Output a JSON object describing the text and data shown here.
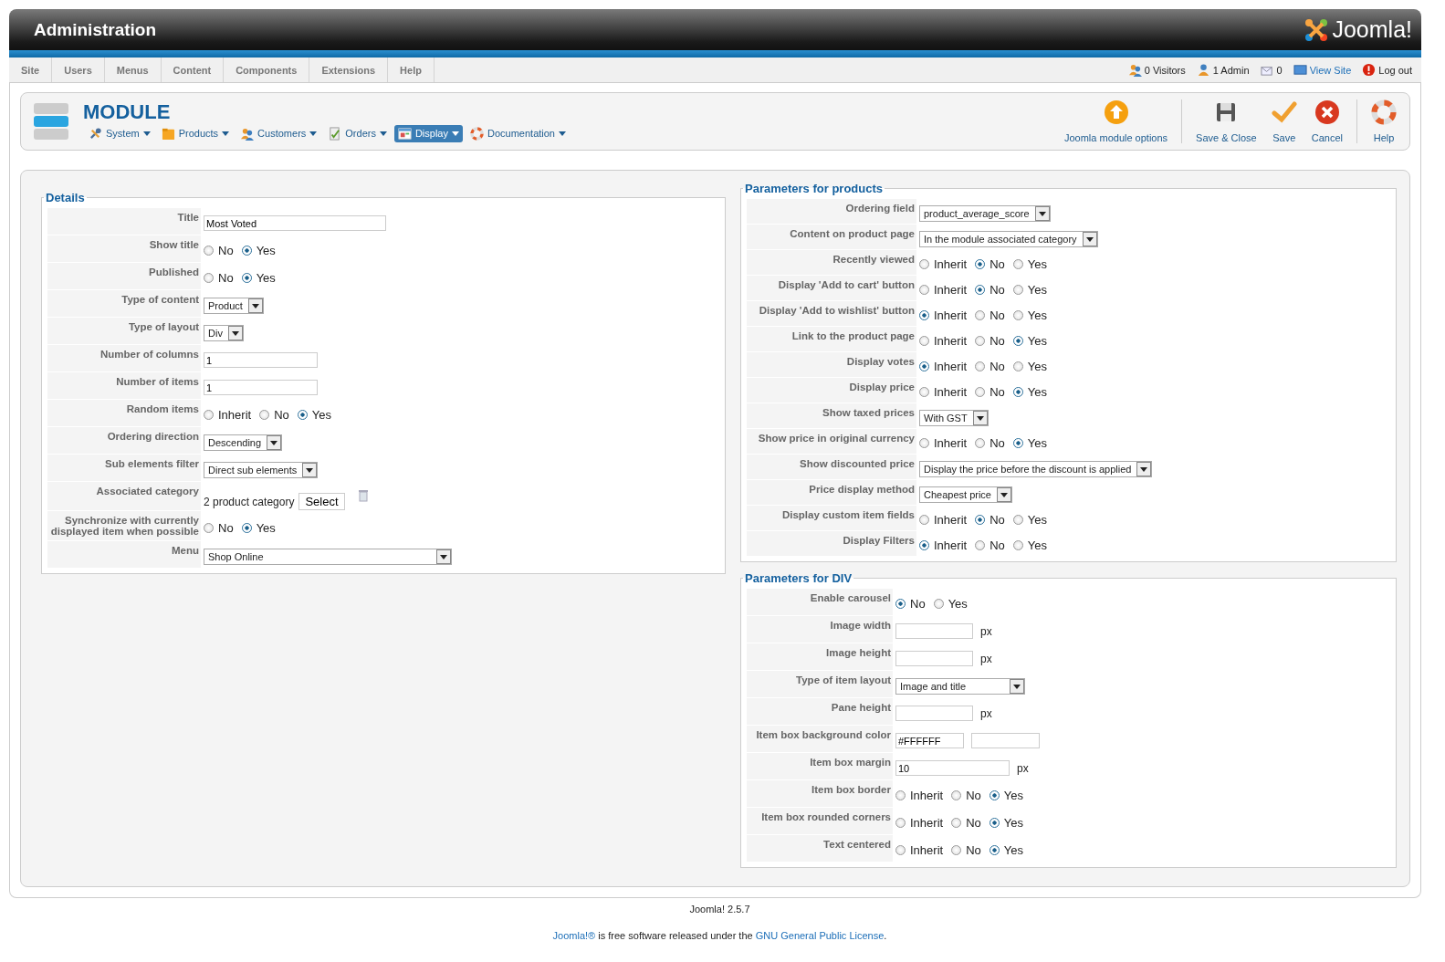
{
  "header": {
    "title": "Administration",
    "logo": "Joomla!"
  },
  "menu": [
    "Site",
    "Users",
    "Menus",
    "Content",
    "Components",
    "Extensions",
    "Help"
  ],
  "status": [
    {
      "label": "0 Visitors",
      "link": false
    },
    {
      "label": "1 Admin",
      "link": false
    },
    {
      "label": "0",
      "link": false
    },
    {
      "label": "View Site",
      "link": true
    },
    {
      "label": "Log out",
      "link": false
    }
  ],
  "toolbar": {
    "title": "MODULE",
    "submenu": [
      {
        "label": "System",
        "selected": false
      },
      {
        "label": "Products",
        "selected": false
      },
      {
        "label": "Customers",
        "selected": false
      },
      {
        "label": "Orders",
        "selected": false
      },
      {
        "label": "Display",
        "selected": true
      },
      {
        "label": "Documentation",
        "selected": false
      }
    ],
    "buttons": [
      "Joomla module options",
      "Save & Close",
      "Save",
      "Cancel",
      "Help"
    ]
  },
  "columns": [
    {
      "sections": [
        {
          "legend": "Details",
          "rows": [
            {
              "label": "Title",
              "kind": "text",
              "value": "Most Voted"
            },
            {
              "label": "Show title",
              "kind": "radio",
              "options": [
                {
                  "label": "No",
                  "selected": false
                },
                {
                  "label": "Yes",
                  "selected": true
                }
              ]
            },
            {
              "label": "Published",
              "kind": "radio",
              "options": [
                {
                  "label": "No",
                  "selected": false
                },
                {
                  "label": "Yes",
                  "selected": true
                }
              ]
            },
            {
              "label": "Type of content",
              "kind": "select",
              "value": "Product"
            },
            {
              "label": "Type of layout",
              "kind": "select",
              "value": "Div"
            },
            {
              "label": "Number of columns",
              "kind": "text",
              "value": "1"
            },
            {
              "label": "Number of items",
              "kind": "text",
              "value": "1"
            },
            {
              "label": "Random items",
              "kind": "radio",
              "options": [
                {
                  "label": "Inherit",
                  "selected": false
                },
                {
                  "label": "No",
                  "selected": false
                },
                {
                  "label": "Yes",
                  "selected": true
                }
              ]
            },
            {
              "label": "Ordering direction",
              "kind": "select",
              "value": "Descending"
            },
            {
              "label": "Sub elements filter",
              "kind": "select",
              "value": "Direct sub elements"
            },
            {
              "label": "Associated category",
              "kind": "category",
              "value": "2 product category",
              "button": "Select"
            },
            {
              "label": "Synchronize with currently displayed item when possible",
              "kind": "radio",
              "options": [
                {
                  "label": "No",
                  "selected": false
                },
                {
                  "label": "Yes",
                  "selected": true
                }
              ]
            },
            {
              "label": "Menu",
              "kind": "select",
              "value": "Shop Online"
            }
          ]
        }
      ]
    },
    {
      "sections": [
        {
          "legend": "Parameters for products",
          "rows": [
            {
              "label": "Ordering field",
              "kind": "select",
              "value": "product_average_score"
            },
            {
              "label": "Content on product page",
              "kind": "select",
              "value": "In the module associated category"
            },
            {
              "label": "Recently viewed",
              "kind": "radio",
              "options": [
                {
                  "label": "Inherit",
                  "selected": false
                },
                {
                  "label": "No",
                  "selected": true
                },
                {
                  "label": "Yes",
                  "selected": false
                }
              ]
            },
            {
              "label": "Display 'Add to cart' button",
              "kind": "radio",
              "options": [
                {
                  "label": "Inherit",
                  "selected": false
                },
                {
                  "label": "No",
                  "selected": true
                },
                {
                  "label": "Yes",
                  "selected": false
                }
              ]
            },
            {
              "label": "Display 'Add to wishlist' button",
              "kind": "radio",
              "options": [
                {
                  "label": "Inherit",
                  "selected": true
                },
                {
                  "label": "No",
                  "selected": false
                },
                {
                  "label": "Yes",
                  "selected": false
                }
              ]
            },
            {
              "label": "Link to the product page",
              "kind": "radio",
              "options": [
                {
                  "label": "Inherit",
                  "selected": false
                },
                {
                  "label": "No",
                  "selected": false
                },
                {
                  "label": "Yes",
                  "selected": true
                }
              ]
            },
            {
              "label": "Display votes",
              "kind": "radio",
              "options": [
                {
                  "label": "Inherit",
                  "selected": true
                },
                {
                  "label": "No",
                  "selected": false
                },
                {
                  "label": "Yes",
                  "selected": false
                }
              ]
            },
            {
              "label": "Display price",
              "kind": "radio",
              "options": [
                {
                  "label": "Inherit",
                  "selected": false
                },
                {
                  "label": "No",
                  "selected": false
                },
                {
                  "label": "Yes",
                  "selected": true
                }
              ]
            },
            {
              "label": "Show taxed prices",
              "kind": "select",
              "value": "With GST"
            },
            {
              "label": "Show price in original currency",
              "kind": "radio",
              "options": [
                {
                  "label": "Inherit",
                  "selected": false
                },
                {
                  "label": "No",
                  "selected": false
                },
                {
                  "label": "Yes",
                  "selected": true
                }
              ]
            },
            {
              "label": "Show discounted price",
              "kind": "select",
              "value": "Display the price before the discount is applied"
            },
            {
              "label": "Price display method",
              "kind": "select",
              "value": "Cheapest price"
            },
            {
              "label": "Display custom item fields",
              "kind": "radio",
              "options": [
                {
                  "label": "Inherit",
                  "selected": false
                },
                {
                  "label": "No",
                  "selected": true
                },
                {
                  "label": "Yes",
                  "selected": false
                }
              ]
            },
            {
              "label": "Display Filters",
              "kind": "radio",
              "options": [
                {
                  "label": "Inherit",
                  "selected": true
                },
                {
                  "label": "No",
                  "selected": false
                },
                {
                  "label": "Yes",
                  "selected": false
                }
              ]
            }
          ]
        },
        {
          "legend": "Parameters for DIV",
          "rows": [
            {
              "label": "Enable carousel",
              "kind": "radio",
              "options": [
                {
                  "label": "No",
                  "selected": true
                },
                {
                  "label": "Yes",
                  "selected": false
                }
              ]
            },
            {
              "label": "Image width",
              "kind": "text",
              "unit": "px"
            },
            {
              "label": "Image height",
              "kind": "text",
              "unit": "px"
            },
            {
              "label": "Type of item layout",
              "kind": "select",
              "value": "Image and title"
            },
            {
              "label": "Pane height",
              "kind": "text",
              "unit": "px"
            },
            {
              "label": "Item box background color",
              "kind": "color",
              "value": "#FFFFFF"
            },
            {
              "label": "Item box margin",
              "kind": "text",
              "value": "10",
              "unit": "px"
            },
            {
              "label": "Item box border",
              "kind": "radio",
              "options": [
                {
                  "label": "Inherit",
                  "selected": false
                },
                {
                  "label": "No",
                  "selected": false
                },
                {
                  "label": "Yes",
                  "selected": true
                }
              ]
            },
            {
              "label": "Item box rounded corners",
              "kind": "radio",
              "options": [
                {
                  "label": "Inherit",
                  "selected": false
                },
                {
                  "label": "No",
                  "selected": false
                },
                {
                  "label": "Yes",
                  "selected": true
                }
              ]
            },
            {
              "label": "Text centered",
              "kind": "radio",
              "options": [
                {
                  "label": "Inherit",
                  "selected": false
                },
                {
                  "label": "No",
                  "selected": false
                },
                {
                  "label": "Yes",
                  "selected": true
                }
              ]
            }
          ]
        }
      ]
    }
  ],
  "footer": {
    "version": "Joomla! 2.5.7",
    "link": "Joomla!®",
    "text": "is free software released under the",
    "license_link": "GNU General Public License",
    "end": "."
  }
}
